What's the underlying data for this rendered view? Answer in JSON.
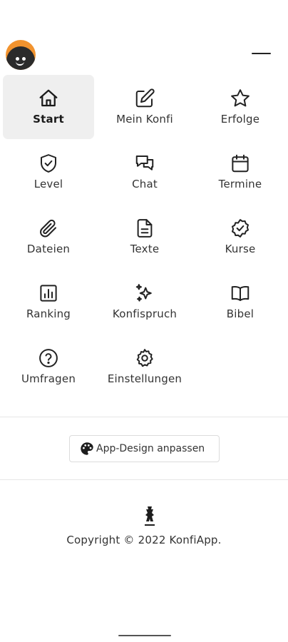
{
  "header": {
    "avatar_icon": "avatar-face-icon",
    "menu_icon": "menu-line-icon"
  },
  "accent_color": "#f2932e",
  "active_item": "Start",
  "menu": [
    {
      "label": "Start",
      "icon": "home-icon"
    },
    {
      "label": "Mein Konfi",
      "icon": "edit-icon"
    },
    {
      "label": "Erfolge",
      "icon": "star-icon"
    },
    {
      "label": "Level",
      "icon": "shield-check-icon"
    },
    {
      "label": "Chat",
      "icon": "chat-icon"
    },
    {
      "label": "Termine",
      "icon": "calendar-icon"
    },
    {
      "label": "Dateien",
      "icon": "paperclip-icon"
    },
    {
      "label": "Texte",
      "icon": "document-icon"
    },
    {
      "label": "Kurse",
      "icon": "badge-check-icon"
    },
    {
      "label": "Ranking",
      "icon": "chart-icon"
    },
    {
      "label": "Konfispruch",
      "icon": "sparkles-icon"
    },
    {
      "label": "Bibel",
      "icon": "book-icon"
    },
    {
      "label": "Umfragen",
      "icon": "question-icon"
    },
    {
      "label": "Einstellungen",
      "icon": "gear-icon"
    }
  ],
  "design_button": {
    "label": "App-Design anpassen",
    "icon": "palette-icon"
  },
  "footer": {
    "logo_icon": "konfiapp-logo-icon",
    "copyright": "Copyright © 2022 KonfiApp."
  }
}
